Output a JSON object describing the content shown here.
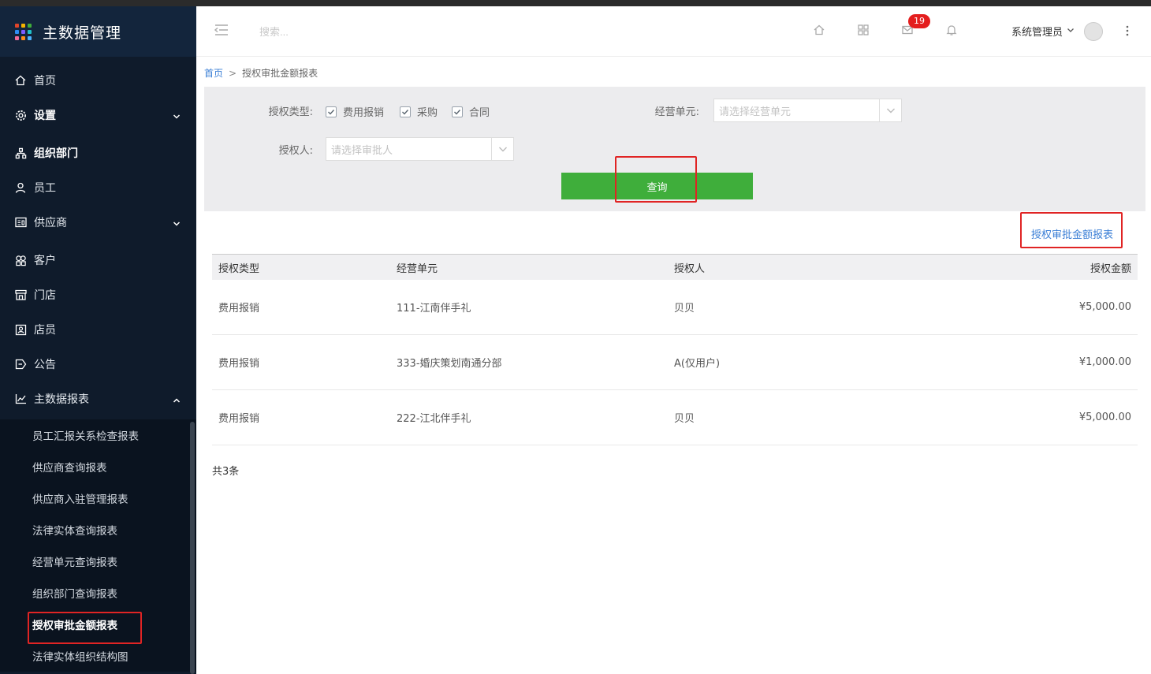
{
  "app": {
    "title": "主数据管理",
    "logo_colors": [
      "#e0452a",
      "#f5b400",
      "#3fae3b",
      "#2f8ef4",
      "#7b5cff",
      "#1fc1c9",
      "#f56b9a",
      "#ff8c1a",
      "#4db3ff"
    ]
  },
  "sidebar": {
    "items": [
      {
        "label": "首页",
        "icon": "home-icon"
      },
      {
        "label": "设置",
        "icon": "gear-icon",
        "expandable": true
      },
      {
        "label": "组织部门",
        "icon": "org-icon"
      },
      {
        "label": "员工",
        "icon": "user-icon"
      },
      {
        "label": "供应商",
        "icon": "card-icon",
        "expandable": true
      },
      {
        "label": "客户",
        "icon": "customer-icon"
      },
      {
        "label": "门店",
        "icon": "store-icon"
      },
      {
        "label": "店员",
        "icon": "clerk-icon"
      },
      {
        "label": "公告",
        "icon": "announce-icon"
      },
      {
        "label": "主数据报表",
        "icon": "chart-icon",
        "expanded": true
      }
    ],
    "report_items": [
      "员工汇报关系检查报表",
      "供应商查询报表",
      "供应商入驻管理报表",
      "法律实体查询报表",
      "经营单元查询报表",
      "组织部门查询报表",
      "授权审批金额报表",
      "法律实体组织结构图"
    ],
    "active_report": "授权审批金额报表"
  },
  "header": {
    "search_placeholder": "搜索...",
    "message_count": "19",
    "user_name": "系统管理员"
  },
  "breadcrumb": {
    "home": "首页",
    "separator": ">",
    "current": "授权审批金额报表"
  },
  "filter": {
    "auth_type_label": "授权类型:",
    "auth_types": [
      "费用报销",
      "采购",
      "合同"
    ],
    "business_unit_label": "经营单元:",
    "business_unit_placeholder": "请选择经营单元",
    "approver_label": "授权人:",
    "approver_placeholder": "请选择审批人",
    "query_button": "查询"
  },
  "report_link": "授权审批金额报表",
  "table": {
    "headers": [
      "授权类型",
      "经营单元",
      "授权人",
      "授权金额"
    ],
    "rows": [
      [
        "费用报销",
        "111-江南伴手礼",
        "贝贝",
        "¥5,000.00"
      ],
      [
        "费用报销",
        "333-婚庆策划南通分部",
        "A(仅用户)",
        "¥1,000.00"
      ],
      [
        "费用报销",
        "222-江北伴手礼",
        "贝贝",
        "¥5,000.00"
      ]
    ]
  },
  "total_text": "共3条",
  "colors": {
    "sidebar_bg": "#0f1b2b",
    "brand_bg": "#13253c",
    "primary_green": "#3fae3b",
    "link_blue": "#3b7fd6",
    "highlight_red": "#e02424",
    "badge_red": "#e41e1e"
  }
}
